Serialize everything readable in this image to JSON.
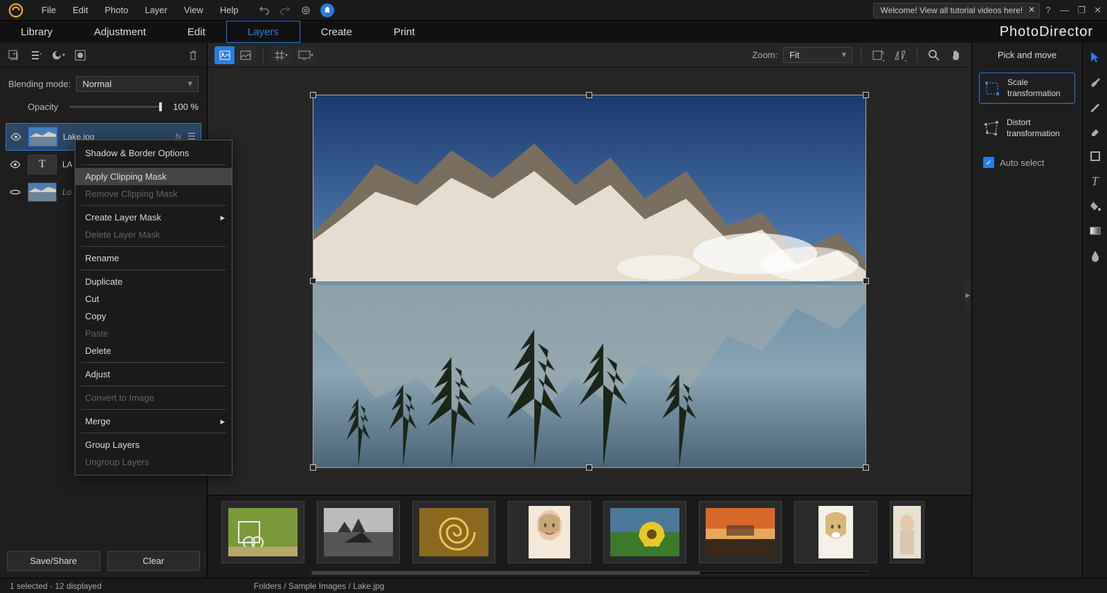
{
  "menu": {
    "file": "File",
    "edit": "Edit",
    "photo": "Photo",
    "layer": "Layer",
    "view": "View",
    "help": "Help"
  },
  "welcome": {
    "text": "Welcome! View all tutorial videos here!"
  },
  "tabs": {
    "library": "Library",
    "adjustment": "Adjustment",
    "edit": "Edit",
    "layers": "Layers",
    "create": "Create",
    "print": "Print"
  },
  "brand": "PhotoDirector",
  "left": {
    "blend_label": "Blending mode:",
    "blend_value": "Normal",
    "opacity_label": "Opacity",
    "opacity_value": "100 %",
    "layers": [
      {
        "name": "Lake.jpg",
        "fx": "fx"
      },
      {
        "name": "LA"
      },
      {
        "name": "Lo"
      }
    ],
    "save_share": "Save/Share",
    "clear": "Clear"
  },
  "ctx": {
    "shadow": "Shadow & Border Options",
    "apply_clip": "Apply Clipping Mask",
    "remove_clip": "Remove Clipping Mask",
    "create_mask": "Create Layer Mask",
    "delete_mask": "Delete Layer Mask",
    "rename": "Rename",
    "duplicate": "Duplicate",
    "cut": "Cut",
    "copy": "Copy",
    "paste": "Paste",
    "delete": "Delete",
    "adjust": "Adjust",
    "convert": "Convert to Image",
    "merge": "Merge",
    "group": "Group Layers",
    "ungroup": "Ungroup Layers"
  },
  "canvas": {
    "zoom_label": "Zoom:",
    "zoom_value": "Fit"
  },
  "right": {
    "title": "Pick and move",
    "scale": "Scale transformation",
    "distort": "Distort transformation",
    "auto_select": "Auto select"
  },
  "status": {
    "selected": "1 selected - 12 displayed",
    "path": "Folders / Sample Images / Lake.jpg"
  }
}
